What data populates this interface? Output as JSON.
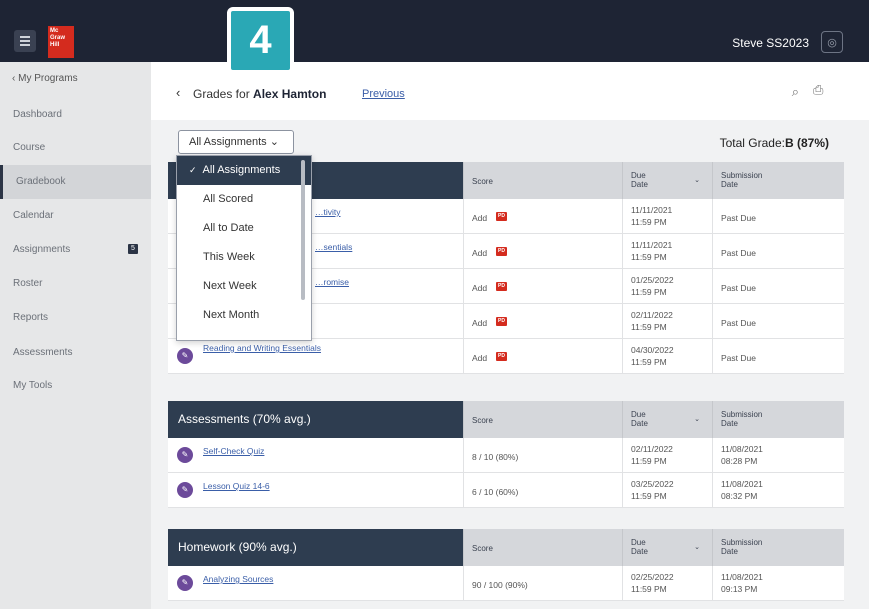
{
  "topbar": {
    "logo_text": "Mc Graw Hill",
    "step_badge": "4",
    "user_name": "Steve SS2023"
  },
  "sidebar": {
    "back_label": "My Programs",
    "items": [
      {
        "label": "Dashboard"
      },
      {
        "label": "Course"
      },
      {
        "label": "Gradebook",
        "active": true
      },
      {
        "label": "Calendar"
      },
      {
        "label": "Assignments",
        "badge": "5"
      },
      {
        "label": "Roster"
      },
      {
        "label": "Reports"
      },
      {
        "label": "Assessments"
      },
      {
        "label": "My Tools"
      }
    ]
  },
  "header": {
    "title_prefix": "Grades for",
    "student_name": "Alex Hamton",
    "previous_link": "Previous"
  },
  "filter": {
    "selected": "All Assignments",
    "options": [
      "All Assignments",
      "All Scored",
      "All to Date",
      "This Week",
      "Next Week",
      "Next Month"
    ]
  },
  "total_grade": {
    "label": "Total Grade:",
    "value": "B (87%)"
  },
  "columns": {
    "score": "Score",
    "due_1": "Due",
    "due_2": "Date",
    "submission_1": "Submission",
    "submission_2": "Date"
  },
  "assignments": {
    "rows": [
      {
        "name": "…tivity",
        "score": "Add",
        "due_date": "11/11/2021",
        "due_time": "11:59 PM",
        "submission": "Past Due"
      },
      {
        "name": "…sentials",
        "score": "Add",
        "due_date": "11/11/2021",
        "due_time": "11:59 PM",
        "submission": "Past Due"
      },
      {
        "name": "…romise",
        "score": "Add",
        "due_date": "01/25/2022",
        "due_time": "11:59 PM",
        "submission": "Past Due"
      },
      {
        "name": "",
        "score": "Add",
        "due_date": "02/11/2022",
        "due_time": "11:59 PM",
        "submission": "Past Due"
      },
      {
        "name": "Reading and Writing Essentials",
        "score": "Add",
        "due_date": "04/30/2022",
        "due_time": "11:59 PM",
        "submission": "Past Due"
      }
    ]
  },
  "assessments": {
    "title": "Assessments (70% avg.)",
    "rows": [
      {
        "name": "Self-Check Quiz",
        "score": "8 / 10 (80%)",
        "due_date": "02/11/2022",
        "due_time": "11:59 PM",
        "sub_date": "11/08/2021",
        "sub_time": "08:28 PM"
      },
      {
        "name": "Lesson Quiz 14-6",
        "score": "6 / 10 (60%)",
        "due_date": "03/25/2022",
        "due_time": "11:59 PM",
        "sub_date": "11/08/2021",
        "sub_time": "08:32 PM"
      }
    ]
  },
  "homework": {
    "title": "Homework (90% avg.)",
    "rows": [
      {
        "name": "Analyzing Sources",
        "score": "90 / 100 (90%)",
        "due_date": "02/25/2022",
        "due_time": "11:59 PM",
        "sub_date": "11/08/2021",
        "sub_time": "09:13 PM"
      }
    ]
  }
}
